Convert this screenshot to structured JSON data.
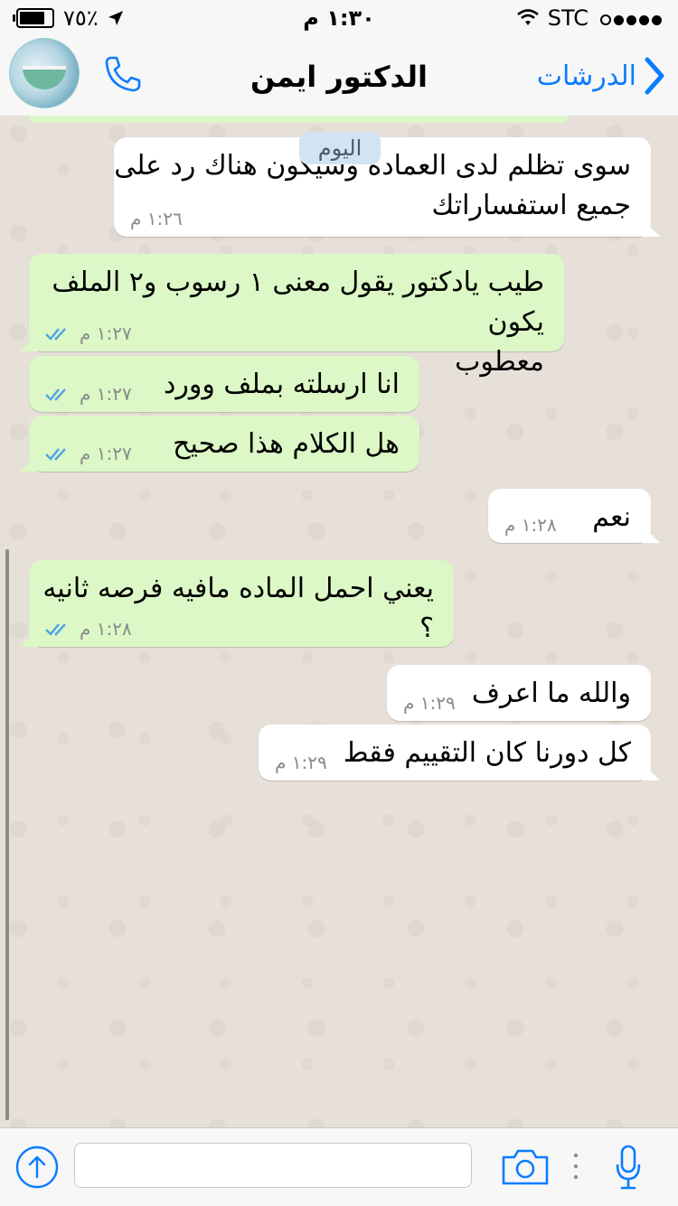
{
  "status_bar": {
    "carrier": "STC",
    "time": "١:٣٠ م",
    "battery_text": "٧٥٪",
    "battery_level": 0.75,
    "signal_bars": 4
  },
  "nav": {
    "back_label": "الدرشات",
    "title": "الدكتور ايمن",
    "accent_color": "#0a7cff"
  },
  "chat": {
    "date_chip": "اليوم",
    "messages": [
      {
        "direction": "in",
        "lines": [
          "سوى تظلم لدى العمادة وسيكون هناك رد على",
          "جميع استفساراتك"
        ],
        "time": "١:٢٦ م"
      },
      {
        "direction": "out",
        "lines": [
          "طيب يادكتور يقول معنى ١ رسوب و٢ الملف يكون",
          "معطوب"
        ],
        "time": "١:٢٧ م",
        "read": true
      },
      {
        "direction": "out",
        "lines": [
          "انا ارسلته بملف وورد"
        ],
        "time": "١:٢٧ م",
        "read": true
      },
      {
        "direction": "out",
        "lines": [
          "هل الكلام هذا صحيح"
        ],
        "time": "١:٢٧ م",
        "read": true
      },
      {
        "direction": "in",
        "lines": [
          "نعم"
        ],
        "time": "١:٢٨ م"
      },
      {
        "direction": "out",
        "lines": [
          "يعني احمل الماده مافيه فرصه ثانيه ؟"
        ],
        "time": "١:٢٨ م",
        "read": true
      },
      {
        "direction": "in",
        "lines": [
          "والله ما اعرف"
        ],
        "time": "١:٢٩ م"
      },
      {
        "direction": "in",
        "lines": [
          "كل دورنا كان التقييم فقط"
        ],
        "time": "١:٢٩ م"
      }
    ],
    "incoming_color": "#ffffff",
    "outgoing_color": "#dcf8c6",
    "read_tick_color": "#4fa3e5"
  },
  "input_bar": {
    "placeholder": ""
  }
}
